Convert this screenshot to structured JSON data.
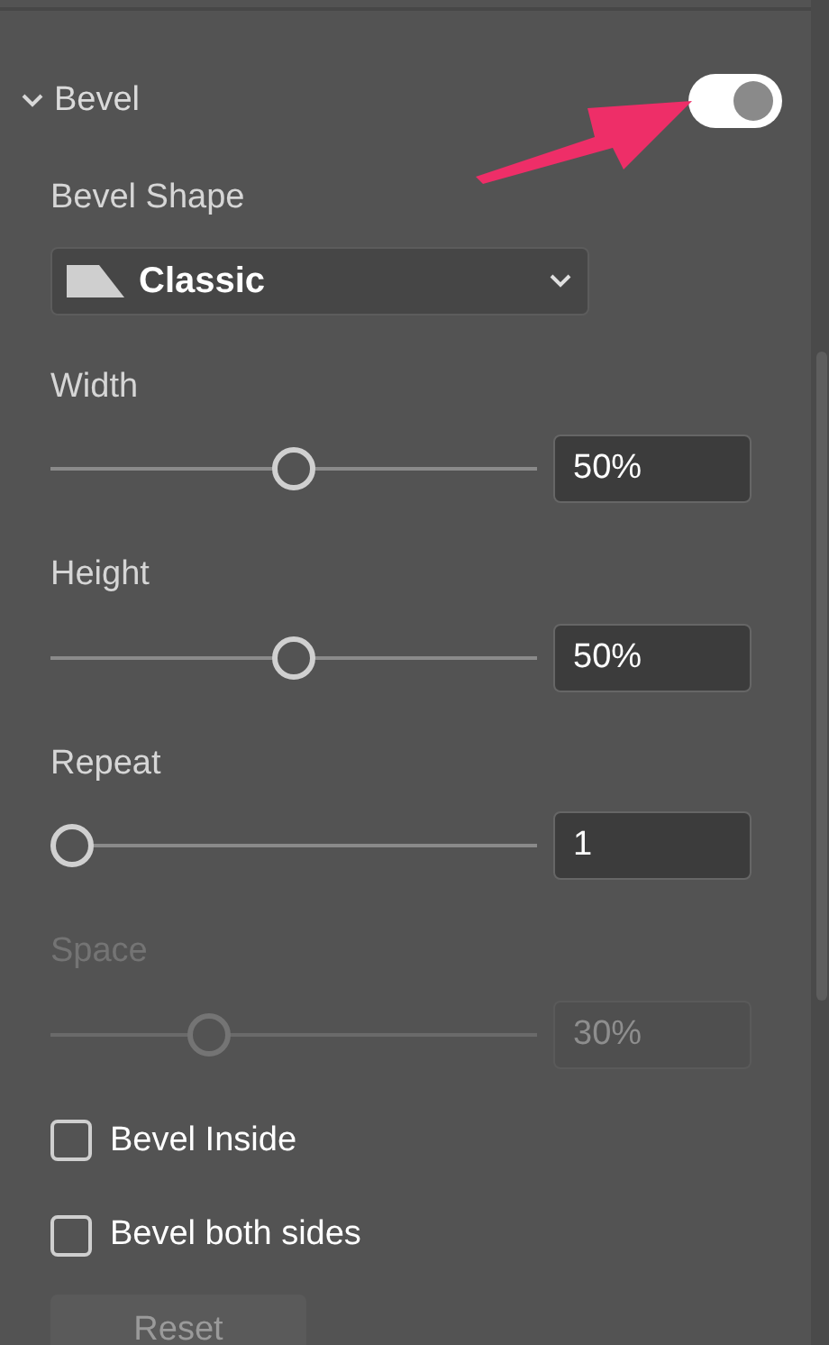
{
  "section": {
    "title": "Bevel",
    "expanded": true,
    "on": true
  },
  "shape": {
    "label": "Bevel Shape",
    "value": "Classic"
  },
  "sliders": [
    {
      "label": "Width",
      "level": 0.5,
      "value": "50%",
      "disabled": false
    },
    {
      "label": "Height",
      "level": 0.5,
      "value": "50%",
      "disabled": false
    },
    {
      "label": "Repeat",
      "level": 0,
      "value": "1",
      "disabled": false
    },
    {
      "label": "Space",
      "level": 0.31,
      "value": "30%",
      "disabled": true
    }
  ],
  "checkboxes": [
    {
      "label": "Bevel Inside",
      "checked": false
    },
    {
      "label": "Bevel both sides",
      "checked": false
    }
  ],
  "reset": {
    "label": "Reset",
    "disabled": true
  }
}
